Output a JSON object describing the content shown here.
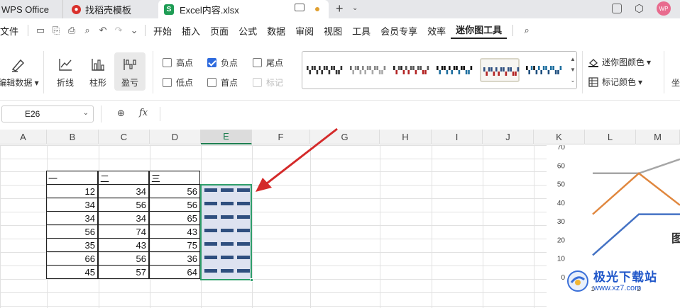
{
  "tabs": [
    {
      "label": "WPS Office"
    },
    {
      "label": "找稻壳模板",
      "icon": "docer-icon"
    },
    {
      "label": "Excel内容.xlsx",
      "icon": "sheet-s-icon",
      "letter": "S"
    }
  ],
  "menu": {
    "file": "文件",
    "items": [
      "开始",
      "插入",
      "页面",
      "公式",
      "数据",
      "审阅",
      "视图",
      "工具",
      "会员专享",
      "效率",
      "迷你图工具"
    ],
    "active": "迷你图工具"
  },
  "ribbon": {
    "edit_data": "编辑数据",
    "types": [
      {
        "label": "折线",
        "icon": "line-chart-icon"
      },
      {
        "label": "柱形",
        "icon": "column-chart-icon"
      },
      {
        "label": "盈亏",
        "icon": "win-loss-icon"
      }
    ],
    "checks": [
      {
        "label": "高点",
        "checked": false
      },
      {
        "label": "负点",
        "checked": true
      },
      {
        "label": "尾点",
        "checked": false
      },
      {
        "label": "低点",
        "checked": false
      },
      {
        "label": "首点",
        "checked": false
      },
      {
        "label": "标记",
        "checked": false,
        "disabled": true
      }
    ],
    "sparkline_color": "迷你图颜色",
    "marker_color": "标记颜色",
    "cut_label": "坐"
  },
  "formula_bar": {
    "cell_ref": "E26",
    "fx": "fx"
  },
  "columns": [
    "A",
    "B",
    "C",
    "D",
    "E",
    "F",
    "G",
    "H",
    "I",
    "J",
    "K",
    "L",
    "M"
  ],
  "table": {
    "headers": [
      "一",
      "二",
      "三"
    ],
    "rows": [
      [
        "12",
        "34",
        "56"
      ],
      [
        "34",
        "56",
        "56"
      ],
      [
        "34",
        "34",
        "65"
      ],
      [
        "56",
        "74",
        "43"
      ],
      [
        "35",
        "43",
        "75"
      ],
      [
        "66",
        "56",
        "36"
      ],
      [
        "45",
        "57",
        "64"
      ]
    ]
  },
  "chart_data": {
    "type": "line",
    "ylim": [
      0,
      70
    ],
    "yticks": [
      "70",
      "60",
      "50",
      "40",
      "30",
      "20",
      "10",
      "0"
    ],
    "x": [
      "1",
      "2"
    ],
    "series": [
      {
        "values": [
          56,
          56
        ],
        "color": "#a6a6a6"
      },
      {
        "values": [
          34,
          56
        ],
        "color": "#e0873e"
      },
      {
        "values": [
          12,
          34
        ],
        "color": "#4472c4"
      }
    ],
    "title_partial": "图"
  },
  "watermark": {
    "name": "极光下载站",
    "url": "www.xz7.com"
  },
  "colors": {
    "accent": "#2e9e6a",
    "sparkline": "#2f4f7f",
    "arrow": "#d42a2a"
  }
}
